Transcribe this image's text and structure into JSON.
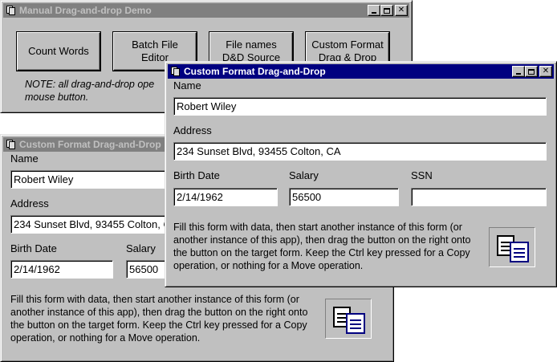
{
  "main_window": {
    "title": "Manual Drag-and-drop Demo",
    "buttons": [
      {
        "label": "Count Words"
      },
      {
        "label": "Batch File Editor"
      },
      {
        "label": "File names D&D Source"
      },
      {
        "label": "Custom Format Drag & Drop"
      }
    ],
    "note": "NOTE: all drag-and-drop ope... mouse button.",
    "note_line1": "NOTE: all drag-and-drop ope",
    "note_line2": "mouse button."
  },
  "back_form": {
    "title": "Custom Format Drag-and-Drop",
    "name_label": "Name",
    "name_value": "Robert Wiley",
    "address_label": "Address",
    "address_value": "234 Sunset Blvd, 93455 Colton, CA",
    "birth_label": "Birth Date",
    "birth_value": "2/14/1962",
    "salary_label": "Salary",
    "salary_value": "56500",
    "instructions": "Fill this form with data, then start another instance of this form (or another instance of this app), then drag the button on the right onto the button on the target form. Keep the Ctrl key pressed for a Copy operation, or nothing for a Move operation."
  },
  "front_form": {
    "title": "Custom Format Drag-and-Drop",
    "name_label": "Name",
    "name_value": "Robert Wiley",
    "address_label": "Address",
    "address_value": "234 Sunset Blvd, 93455 Colton, CA",
    "birth_label": "Birth Date",
    "birth_value": "2/14/1962",
    "salary_label": "Salary",
    "salary_value": "56500",
    "ssn_label": "SSN",
    "ssn_value": "",
    "instructions": "Fill this form with data, then start another instance of this form (or another instance of this app), then drag the button on the right onto the button on the target form. Keep the Ctrl key pressed for a Copy operation, or nothing for a Move operation."
  },
  "icons": {
    "window_icon": "window-app-icon",
    "drag_source_icon": "copy-documents-icon",
    "minimize": "minimize-icon",
    "maximize": "maximize-icon",
    "close": "close-icon",
    "close_glyph": "✕"
  },
  "colors": {
    "active_title": "#000080",
    "inactive_title": "#808080",
    "face": "#c0c0c0"
  }
}
